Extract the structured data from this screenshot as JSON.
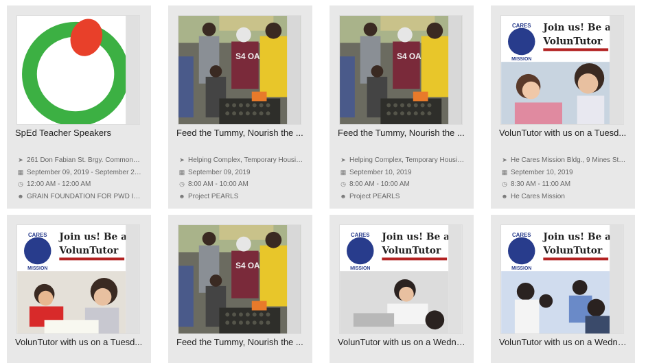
{
  "colors": {
    "card_bg": "#e8e8e8",
    "logo_green": "#3cb043",
    "logo_red": "#e8402a",
    "cares_blue": "#283c8c",
    "banner_red": "#b22222"
  },
  "icons": {
    "location": "location-arrow-icon",
    "date": "calendar-icon",
    "time": "clock-icon",
    "org": "users-icon"
  },
  "cards": [
    {
      "title": "SpEd Teacher Speakers",
      "image": "green-red-logo",
      "location": "261 Don Fabian St. Brgy. Commonwea...",
      "date": "September 09, 2019 - September 27, 2...",
      "time": "12:00 AM - 12:00 AM",
      "org": "GRAIN FOUNDATION FOR PWD INC."
    },
    {
      "title": "Feed the Tummy, Nourish the ...",
      "image": "feeding-photo",
      "location": "Helping Complex, Temporary Housing, ...",
      "date": "September 09, 2019",
      "time": "8:00 AM - 10:00 AM",
      "org": "Project PEARLS"
    },
    {
      "title": "Feed the Tummy, Nourish the ...",
      "image": "feeding-photo",
      "location": "Helping Complex, Temporary Housing, ...",
      "date": "September 10, 2019",
      "time": "8:00 AM - 10:00 AM",
      "org": "Project PEARLS"
    },
    {
      "title": "VolunTutor with us on a Tuesd...",
      "image": "voluntutor-poster",
      "location": "He Cares Mission Bldg., 9 Mines St. Pr...",
      "date": "September 10, 2019",
      "time": "8:30 AM - 11:00 AM",
      "org": "He Cares Mission"
    },
    {
      "title": "VolunTutor with us on a Tuesd...",
      "image": "voluntutor-poster"
    },
    {
      "title": "Feed the Tummy, Nourish the ...",
      "image": "feeding-photo"
    },
    {
      "title": "VolunTutor with us on a Wedne...",
      "image": "voluntutor-poster"
    },
    {
      "title": "VolunTutor with us on a Wedne...",
      "image": "voluntutor-poster"
    }
  ],
  "poster": {
    "brand_top": "CARES",
    "brand_bottom": "MISSION",
    "headline_1": "Join us! Be a",
    "headline_2": "VolunTutor"
  },
  "feeding_shirt_text": "S4 OA"
}
